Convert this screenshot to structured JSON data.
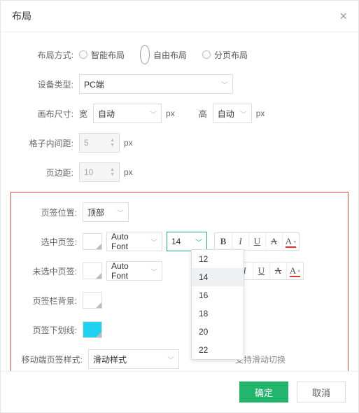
{
  "title": "布局",
  "radios": {
    "label": "布局方式:",
    "opt_smart": "智能布局",
    "opt_free": "自由布局",
    "opt_page": "分页布局"
  },
  "device": {
    "label": "设备类型:",
    "value": "PC端"
  },
  "canvas": {
    "label": "画布尺寸:",
    "width_lbl": "宽",
    "width_val": "自动",
    "height_lbl": "高",
    "height_val": "自动",
    "unit": "px"
  },
  "grid_gap": {
    "label": "格子内间距:",
    "value": "5",
    "unit": "px"
  },
  "page_margin": {
    "label": "页边距:",
    "value": "10",
    "unit": "px"
  },
  "tab_pos": {
    "label": "页签位置:",
    "value": "顶部"
  },
  "sel_tab": {
    "label": "选中页签:",
    "font": "Auto Font",
    "size": "14"
  },
  "unsel_tab": {
    "label": "未选中页签:",
    "font": "Auto Font"
  },
  "tabbar_bg": {
    "label": "页签栏背景:"
  },
  "underline": {
    "label": "页签下划线:"
  },
  "mobile_tab": {
    "label": "移动端页签样式:",
    "value": "滑动样式",
    "hint": "支持滑动切换"
  },
  "dropdown_items": [
    "12",
    "14",
    "16",
    "18",
    "20",
    "22"
  ],
  "buttons": {
    "ok": "确定",
    "cancel": "取消"
  },
  "fmt": {
    "b": "B",
    "i": "I",
    "u": "U",
    "s": "A",
    "c": "A"
  }
}
